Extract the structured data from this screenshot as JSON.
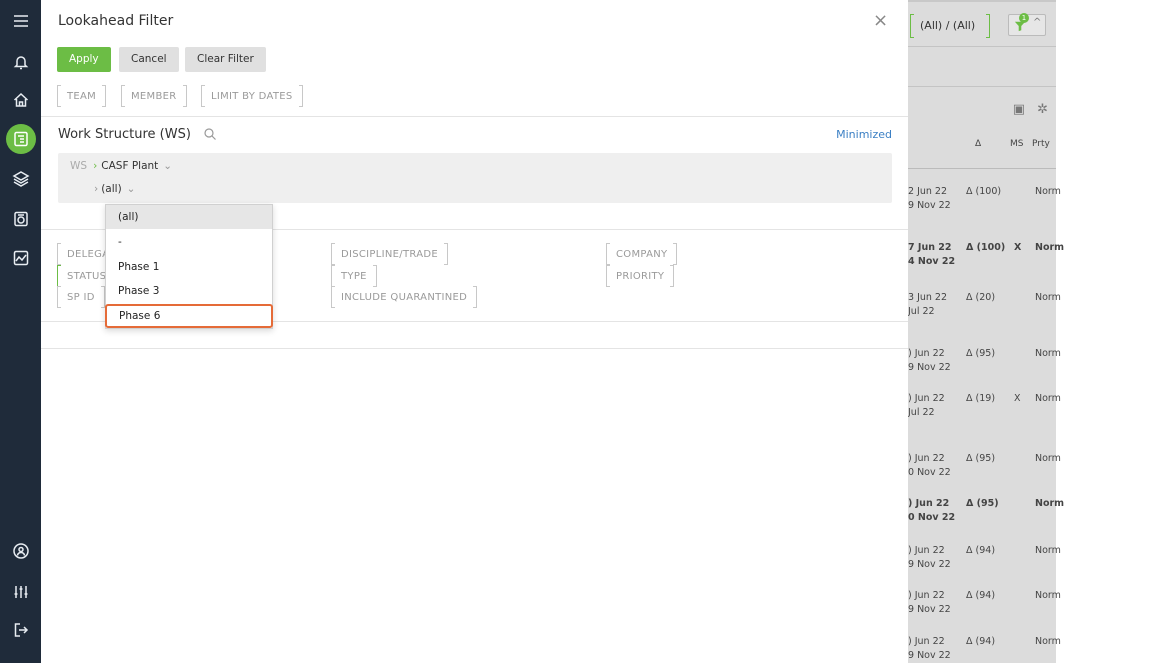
{
  "modal": {
    "title": "Lookahead Filter",
    "close": "×",
    "buttons": {
      "apply": "Apply",
      "cancel": "Cancel",
      "clear": "Clear Filter"
    },
    "top_fields": [
      "TEAM",
      "MEMBER",
      "LIMIT BY DATES"
    ],
    "ws": {
      "title": "Work Structure (WS)",
      "minimized": "Minimized",
      "root": "WS",
      "level1": "CASF Plant",
      "level2": "(all)"
    },
    "dropdown": {
      "options": [
        "(all)",
        "-",
        "Phase 1",
        "Phase 3",
        "Phase 6"
      ],
      "selected": "(all)",
      "highlighted": "Phase 6"
    },
    "filters": {
      "col1": [
        "DELEGA",
        "STATUS",
        "SP ID"
      ],
      "col2": [
        "DISCIPLINE/TRADE",
        "TYPE",
        "INCLUDE QUARANTINED"
      ],
      "col3": [
        "COMPANY",
        "PRIORITY"
      ]
    }
  },
  "background": {
    "filter_value": "(All) / (All)",
    "filter_count": "1",
    "headers": {
      "delta": "Δ",
      "ms": "MS",
      "prty": "Prty"
    },
    "rows": [
      {
        "d1": "2 Jun 22",
        "d2": "9 Nov 22",
        "delta": "Δ (100)",
        "ms": "",
        "prty": "Norm",
        "bold": false
      },
      {
        "d1": "7 Jun 22",
        "d2": "4 Nov 22",
        "delta": "Δ (100)",
        "ms": "X",
        "prty": "Norm",
        "bold": true
      },
      {
        "d1": "3 Jun 22",
        "d2": "Jul 22",
        "delta": "Δ (20)",
        "ms": "",
        "prty": "Norm",
        "bold": false
      },
      {
        "d1": ") Jun 22",
        "d2": "9 Nov 22",
        "delta": "Δ (95)",
        "ms": "",
        "prty": "Norm",
        "bold": false
      },
      {
        "d1": ") Jun 22",
        "d2": "Jul 22",
        "delta": "Δ (19)",
        "ms": "X",
        "prty": "Norm",
        "bold": false
      },
      {
        "d1": ") Jun 22",
        "d2": "0 Nov 22",
        "delta": "Δ (95)",
        "ms": "",
        "prty": "Norm",
        "bold": false
      },
      {
        "d1": ") Jun 22",
        "d2": "0 Nov 22",
        "delta": "Δ (95)",
        "ms": "",
        "prty": "Norm",
        "bold": true
      },
      {
        "d1": ") Jun 22",
        "d2": "9 Nov 22",
        "delta": "Δ (94)",
        "ms": "",
        "prty": "Norm",
        "bold": false
      },
      {
        "d1": ") Jun 22",
        "d2": "9 Nov 22",
        "delta": "Δ (94)",
        "ms": "",
        "prty": "Norm",
        "bold": false
      },
      {
        "d1": ") Jun 22",
        "d2": "9 Nov 22",
        "delta": "Δ (94)",
        "ms": "",
        "prty": "Norm",
        "bold": false
      }
    ]
  },
  "colors": {
    "accent": "#6cbd45",
    "sidebar": "#1f2b3a",
    "highlight": "#e56b38",
    "link": "#3a7fc4"
  }
}
